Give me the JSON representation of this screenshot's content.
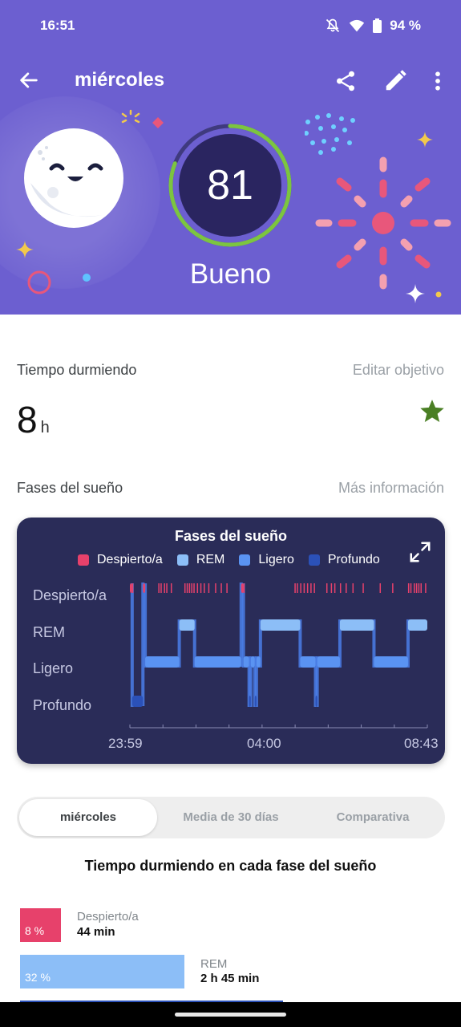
{
  "status_bar": {
    "time": "16:51",
    "battery": "94 %"
  },
  "toolbar": {
    "title": "miércoles"
  },
  "score": {
    "value": "81",
    "label": "Bueno",
    "fraction": 0.81
  },
  "sleep_time": {
    "label": "Tiempo durmiendo",
    "link": "Editar objetivo",
    "value": "8",
    "unit": "h"
  },
  "phases": {
    "label": "Fases del sueño",
    "link": "Más información"
  },
  "colors": {
    "header": "#6c5fd0",
    "card": "#2a2c58",
    "awake": "#e7416b",
    "rem": "#8cbef7",
    "light": "#5a93f2",
    "deep": "#2b51b8",
    "ring": "#7cc540",
    "star": "#4a7f24"
  },
  "chart_data": {
    "type": "area",
    "title": "Fases del sueño",
    "legend": [
      "Despierto/a",
      "REM",
      "Ligero",
      "Profundo"
    ],
    "y_categories": [
      "Despierto/a",
      "REM",
      "Ligero",
      "Profundo"
    ],
    "x_tick_labels": [
      "23:59",
      "04:00",
      "08:43"
    ],
    "x_range_minutes": [
      0,
      524
    ],
    "legend_position": "top",
    "segments": [
      {
        "stage": "Despierto/a",
        "start": 0,
        "end": 4
      },
      {
        "stage": "Profundo",
        "start": 4,
        "end": 23
      },
      {
        "stage": "Despierto/a",
        "start": 23,
        "end": 27
      },
      {
        "stage": "Ligero",
        "start": 27,
        "end": 87
      },
      {
        "stage": "REM",
        "start": 87,
        "end": 114
      },
      {
        "stage": "Ligero",
        "start": 114,
        "end": 196
      },
      {
        "stage": "Despierto/a",
        "start": 196,
        "end": 200
      },
      {
        "stage": "Ligero",
        "start": 200,
        "end": 210
      },
      {
        "stage": "Profundo",
        "start": 210,
        "end": 213
      },
      {
        "stage": "Ligero",
        "start": 213,
        "end": 220
      },
      {
        "stage": "Profundo",
        "start": 220,
        "end": 223
      },
      {
        "stage": "Ligero",
        "start": 223,
        "end": 230
      },
      {
        "stage": "REM",
        "start": 230,
        "end": 300
      },
      {
        "stage": "Ligero",
        "start": 300,
        "end": 327
      },
      {
        "stage": "Profundo",
        "start": 327,
        "end": 330
      },
      {
        "stage": "Ligero",
        "start": 330,
        "end": 370
      },
      {
        "stage": "REM",
        "start": 370,
        "end": 430
      },
      {
        "stage": "Ligero",
        "start": 430,
        "end": 490
      },
      {
        "stage": "REM",
        "start": 490,
        "end": 524
      }
    ],
    "awake_ticks": [
      4,
      50,
      54,
      60,
      64,
      72,
      96,
      100,
      104,
      108,
      112,
      118,
      124,
      130,
      138,
      150,
      160,
      170,
      200,
      290,
      294,
      300,
      306,
      312,
      318,
      324,
      346,
      354,
      360,
      370,
      380,
      392,
      410,
      440,
      462,
      490,
      494,
      500,
      504,
      508,
      512,
      520
    ]
  },
  "tabs": {
    "day": "miércoles",
    "avg": "Media de 30 días",
    "compare": "Comparativa"
  },
  "breakdown": {
    "title": "Tiempo durmiendo en cada fase del sueño",
    "rows": [
      {
        "name": "Despierto/a",
        "pct": "8 %",
        "duration": "44 min",
        "fraction": 0.08
      },
      {
        "name": "REM",
        "pct": "32 %",
        "duration": "2 h 45 min",
        "fraction": 0.32
      }
    ]
  }
}
